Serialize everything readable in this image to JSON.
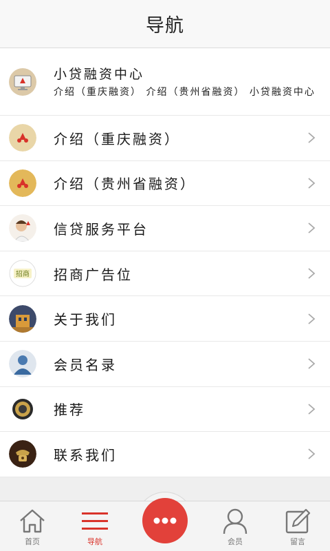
{
  "header": {
    "title": "导航"
  },
  "items": [
    {
      "title": "小贷融资中心",
      "subtitle": "介绍（重庆融资） 介绍（贵州省融资） 小贷融资中心",
      "icon": "monitor-icon"
    },
    {
      "title": "介绍（重庆融资）",
      "icon": "company-logo-icon"
    },
    {
      "title": "介绍（贵州省融资）",
      "icon": "company-logo-icon"
    },
    {
      "title": "信贷服务平台",
      "icon": "person-photo-icon"
    },
    {
      "title": "招商广告位",
      "icon": "ad-badge-icon"
    },
    {
      "title": "关于我们",
      "icon": "building-photo-icon"
    },
    {
      "title": "会员名录",
      "icon": "member-avatar-icon"
    },
    {
      "title": "推荐",
      "icon": "medal-icon"
    },
    {
      "title": "联系我们",
      "icon": "telephone-icon"
    }
  ],
  "tabs": [
    {
      "label": "首页",
      "icon": "home-icon"
    },
    {
      "label": "导航",
      "icon": "menu-icon"
    },
    {
      "label": "",
      "icon": "more-icon"
    },
    {
      "label": "会员",
      "icon": "person-icon"
    },
    {
      "label": "留言",
      "icon": "edit-icon"
    }
  ],
  "colors": {
    "accent": "#e2413a",
    "active_tab": "#d9332a"
  }
}
